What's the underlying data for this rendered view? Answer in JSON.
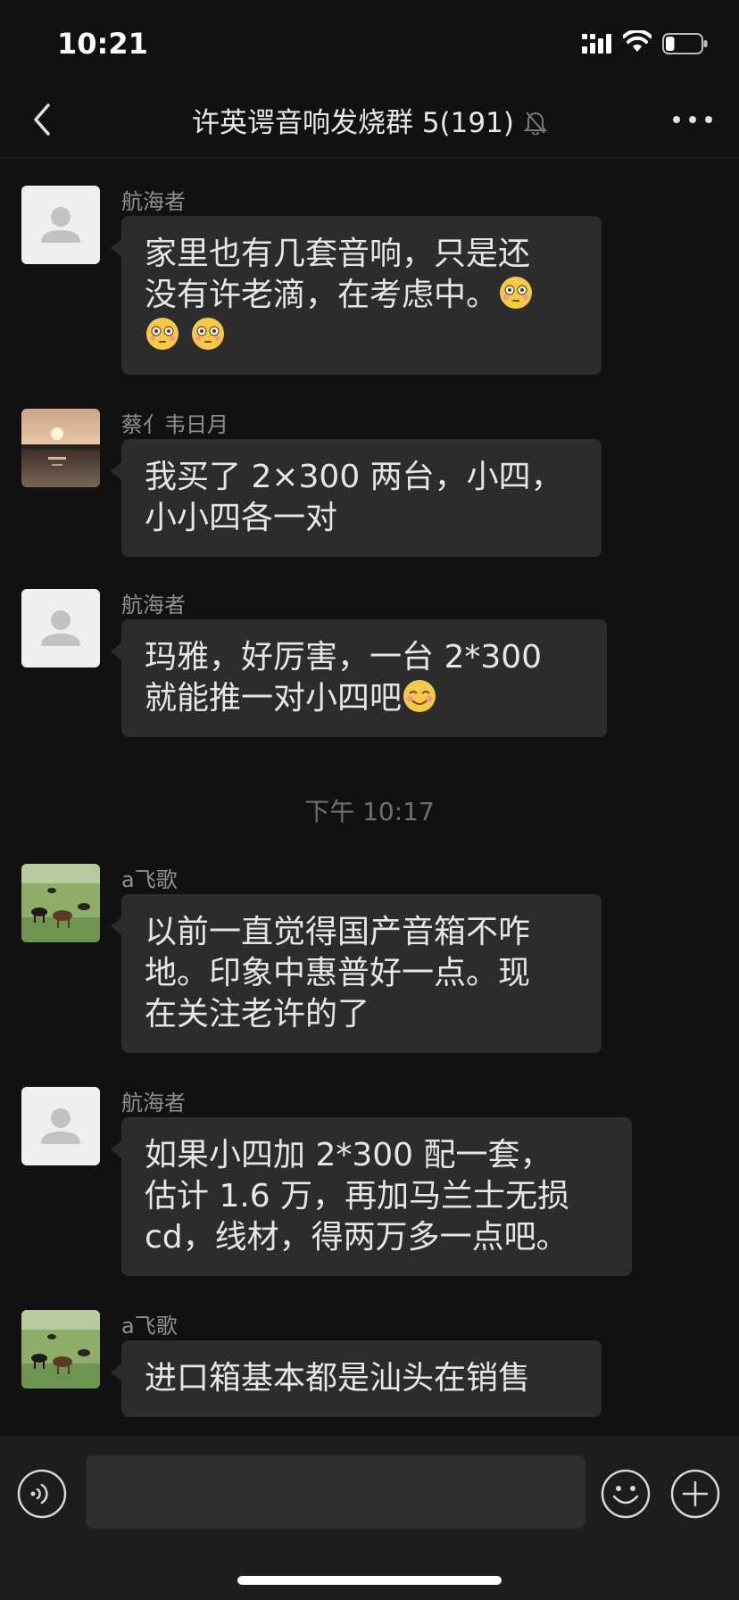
{
  "status_bar": {
    "time": "10:21",
    "battery_level": 0.25
  },
  "header": {
    "title": "许英谔音响发烧群 5(191)"
  },
  "messages": [
    {
      "sender": "航海者",
      "avatar": "default-avatar",
      "lines": [
        "家里也有几套音响，只是还",
        "没有许老滴，在考虑中。"
      ],
      "emojis": [
        "flushed-emoji",
        "flushed-emoji",
        "flushed-emoji"
      ]
    },
    {
      "sender": "蔡亻韦日月",
      "avatar": "sunset-photo-avatar",
      "lines": [
        "我买了 2×300 两台，小四，",
        "小小四各一对"
      ]
    },
    {
      "sender": "航海者",
      "avatar": "default-avatar",
      "lines": [
        "玛雅，好厉害，一台 2*300",
        "就能推一对小四吧"
      ],
      "emojis": [
        "blush-emoji"
      ]
    },
    {
      "sender": "a飞歌",
      "avatar": "horses-photo-avatar",
      "lines": [
        "以前一直觉得国产音箱不咋",
        "地。印象中惠普好一点。现",
        "在关注老许的了"
      ]
    },
    {
      "sender": "航海者",
      "avatar": "default-avatar",
      "lines": [
        "如果小四加 2*300 配一套，",
        "估计 1.6 万，再加马兰士无损",
        "cd，线材，得两万多一点吧。"
      ]
    },
    {
      "sender": "a飞歌",
      "avatar": "horses-photo-avatar",
      "lines": [
        "进口箱基本都是汕头在销售"
      ]
    }
  ],
  "timestamp": "下午 10:17",
  "input": {
    "placeholder": ""
  },
  "icons": {
    "back": "chevron-left-icon",
    "mute": "bell-muted-icon",
    "more": "ellipsis-icon",
    "voice": "voice-icon",
    "emoji": "smiley-icon",
    "plus": "plus-icon"
  },
  "colors": {
    "background": "#111111",
    "bubble": "#2c2c2c",
    "input_bar": "#1d1d1d",
    "text": "#e6e6e6"
  }
}
